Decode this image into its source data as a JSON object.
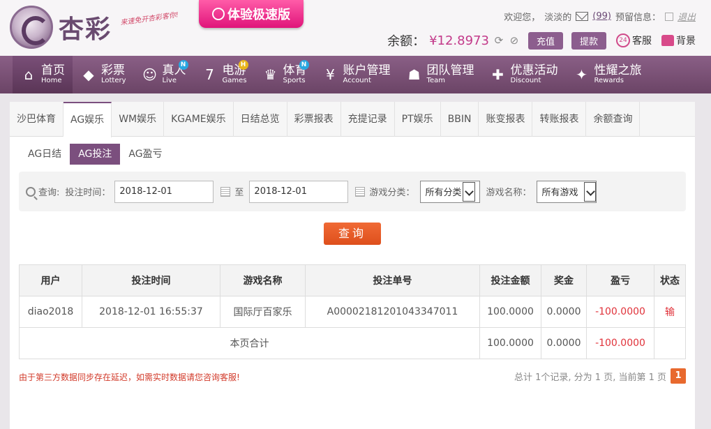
{
  "brand": {
    "name": "杏彩",
    "slogan": "来速免开杏彩客你!",
    "promo": "体验极速版"
  },
  "top": {
    "welcome": "欢迎您，",
    "username": "淡淡的",
    "mail_count": "(99)",
    "notice_label": "预留信息：",
    "logout": "退出"
  },
  "balance": {
    "label": "余额：",
    "value": "¥12.8973",
    "deposit": "充值",
    "withdraw": "提款",
    "service": "客服",
    "background": "背景"
  },
  "nav": [
    {
      "zh": "首页",
      "en": "Home",
      "icon": "home-icon",
      "badge": ""
    },
    {
      "zh": "彩票",
      "en": "Lottery",
      "icon": "lottery-icon",
      "badge": ""
    },
    {
      "zh": "真人",
      "en": "Live",
      "icon": "live-icon",
      "badge": "N"
    },
    {
      "zh": "电游",
      "en": "Games",
      "icon": "games-icon",
      "badge": "H"
    },
    {
      "zh": "体育",
      "en": "Sports",
      "icon": "trophy-icon",
      "badge": "N"
    },
    {
      "zh": "账户管理",
      "en": "Account",
      "icon": "account-icon",
      "badge": ""
    },
    {
      "zh": "团队管理",
      "en": "Team",
      "icon": "team-icon",
      "badge": ""
    },
    {
      "zh": "优惠活动",
      "en": "Discount",
      "icon": "gift-icon",
      "badge": ""
    },
    {
      "zh": "性耀之旅",
      "en": "Rewards",
      "icon": "rewards-icon",
      "badge": ""
    }
  ],
  "tabs": [
    "沙巴体育",
    "AG娱乐",
    "WM娱乐",
    "KGAME娱乐",
    "日结总览",
    "彩票报表",
    "充提记录",
    "PT娱乐",
    "BBIN",
    "账变报表",
    "转账报表",
    "余额查询"
  ],
  "subtabs": [
    "AG日结",
    "AG投注",
    "AG盈亏"
  ],
  "filter": {
    "search_label": "查询:",
    "time_label": "投注时间：",
    "start_date": "2018-12-01",
    "to": "至",
    "end_date": "2018-12-01",
    "category_label": "游戏分类：",
    "category_value": "所有分类",
    "game_label": "游戏名称：",
    "game_value": "所有游戏",
    "query_button": "查询"
  },
  "table": {
    "headers": [
      "用户",
      "投注时间",
      "游戏名称",
      "投注单号",
      "投注金额",
      "奖金",
      "盈亏",
      "状态"
    ],
    "rows": [
      {
        "user": "diao2018",
        "time": "2018-12-01 16:55:37",
        "game": "国际厅百家乐",
        "order": "A00002181201043347011",
        "amount": "100.0000",
        "bonus": "0.0000",
        "profit": "-100.0000",
        "status": "输"
      }
    ],
    "summary": {
      "label": "本页合计",
      "amount": "100.0000",
      "bonus": "0.0000",
      "profit": "-100.0000"
    }
  },
  "footer": {
    "note": "由于第三方数据同步存在延迟，如需实时数据请您咨询客服!",
    "pager_text": "总计 1个记录, 分为 1 页, 当前第 1 页",
    "current_page": "1"
  },
  "colors": {
    "accent": "#7b4f7e",
    "query": "#e8692e",
    "loss": "#e0323a"
  }
}
